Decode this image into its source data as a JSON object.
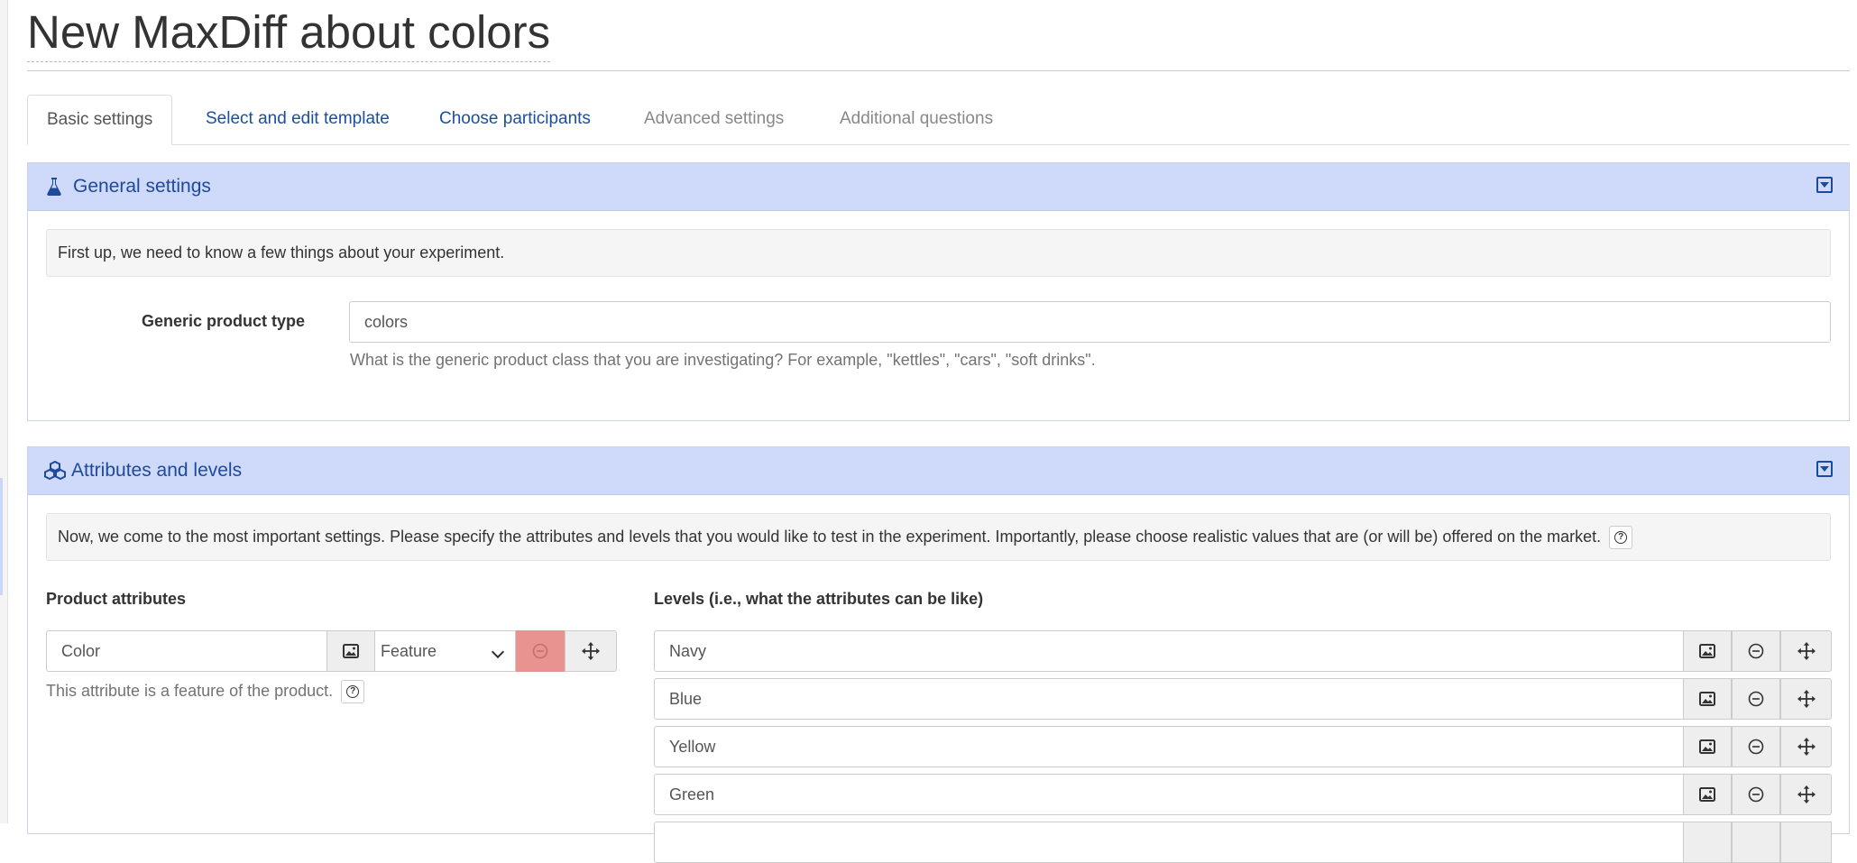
{
  "page": {
    "title": "New MaxDiff about colors"
  },
  "tabs": [
    {
      "label": "Basic settings"
    },
    {
      "label": "Select and edit template"
    },
    {
      "label": "Choose participants"
    },
    {
      "label": "Advanced settings"
    },
    {
      "label": "Additional questions"
    }
  ],
  "general": {
    "title": "General settings",
    "intro": "First up, we need to know a few things about your experiment.",
    "product_type_label": "Generic product type",
    "product_type_value": "colors",
    "product_type_help": "What is the generic product class that you are investigating? For example, \"kettles\", \"cars\", \"soft drinks\"."
  },
  "attributes": {
    "title": "Attributes and levels",
    "intro": "Now, we come to the most important settings. Please specify the attributes and levels that you would like to test in the experiment. Importantly, please choose realistic values that are (or will be) offered on the market.",
    "product_attributes_header": "Product attributes",
    "levels_header": "Levels (i.e., what the attributes can be like)",
    "attribute": {
      "name": "Color",
      "type": "Feature",
      "help": "This attribute is a feature of the product."
    },
    "levels": [
      {
        "value": "Navy"
      },
      {
        "value": "Blue"
      },
      {
        "value": "Yellow"
      },
      {
        "value": "Green"
      },
      {
        "value": ""
      }
    ]
  },
  "icons": {
    "general": "flask-icon",
    "attributes": "cubes-icon",
    "collapse": "collapse-toggle-icon",
    "image": "image-icon",
    "remove": "minus-circle-icon",
    "move": "move-arrows-icon",
    "help": "question-circle-icon"
  },
  "colors": {
    "panel_header_bg": "#cfd9fa",
    "panel_title": "#1e4a9c",
    "link": "#1a4fa0",
    "danger_addon": "#e99391"
  }
}
